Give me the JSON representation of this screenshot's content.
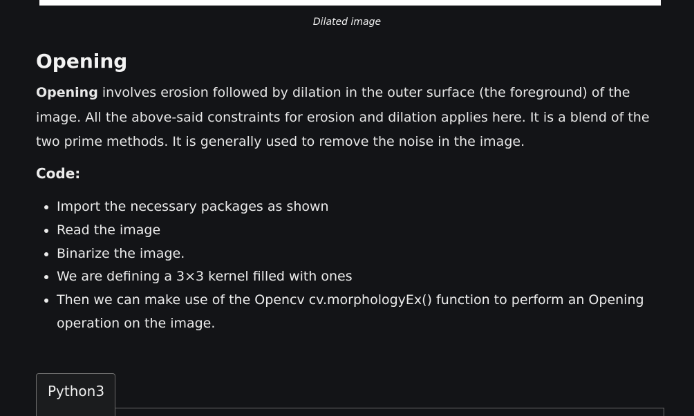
{
  "figure": {
    "caption": "Dilated image"
  },
  "section": {
    "heading": "Opening",
    "intro_bold": "Opening",
    "intro_text": " involves erosion followed by dilation in the outer surface (the foreground) of the image. All the above-said constraints for erosion and dilation applies here. It is a blend of the two prime methods. It is generally used to remove the noise in the image.",
    "code_label": "Code:",
    "steps": [
      "Import the necessary packages as shown",
      "Read the image",
      "Binarize the image.",
      "We are defining a 3×3 kernel filled with ones",
      "Then we can make use of the Opencv cv.morphologyEx() function to perform an Opening operation on the image."
    ]
  },
  "code_block": {
    "tab_label": "Python3"
  },
  "colors": {
    "background": "#131417",
    "text": "#e8e8e8",
    "border": "#6b6b6b"
  }
}
